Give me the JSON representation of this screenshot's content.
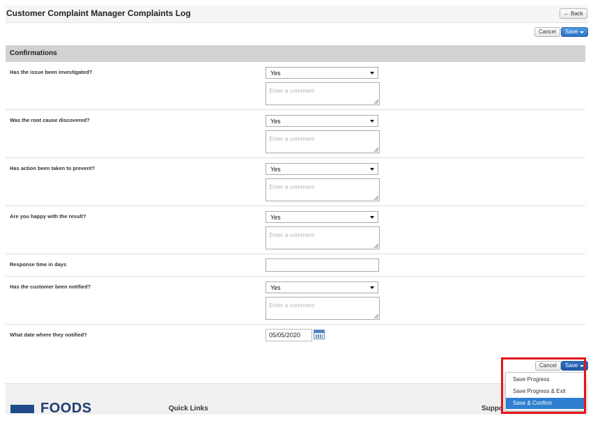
{
  "header": {
    "title": "Customer Complaint Manager Complaints Log",
    "back_label": "Back"
  },
  "toolbar": {
    "cancel_label": "Cancel",
    "save_label": "Save"
  },
  "section": {
    "title": "Confirmations"
  },
  "comment_placeholder": "Enter a comment",
  "questions": [
    {
      "label": "Has the issue been investigated?",
      "answer": "Yes"
    },
    {
      "label": "Was the root cause discovered?",
      "answer": "Yes"
    },
    {
      "label": "Has action been taken to prevent?",
      "answer": "Yes"
    },
    {
      "label": "Are you happy with the result?",
      "answer": "Yes"
    },
    {
      "label": "Response time in days",
      "value": ""
    },
    {
      "label": "Has the customer been notified?",
      "answer": "Yes"
    },
    {
      "label": "What date where they notified?",
      "date": "05/05/2020"
    }
  ],
  "bottom_toolbar": {
    "cancel_label": "Cancel",
    "save_label": "Save"
  },
  "save_menu": {
    "items": [
      "Save Progress",
      "Save Progress & Exit",
      "Save & Confirm"
    ],
    "highlighted_index": 2
  },
  "footer": {
    "logo_text": "FOODS",
    "quick_links_label": "Quick Links",
    "support_label": "Suppo"
  },
  "colors": {
    "primary": "#2e72c5",
    "highlight_border": "#e4141b",
    "menu_active": "#2f7fd0"
  }
}
